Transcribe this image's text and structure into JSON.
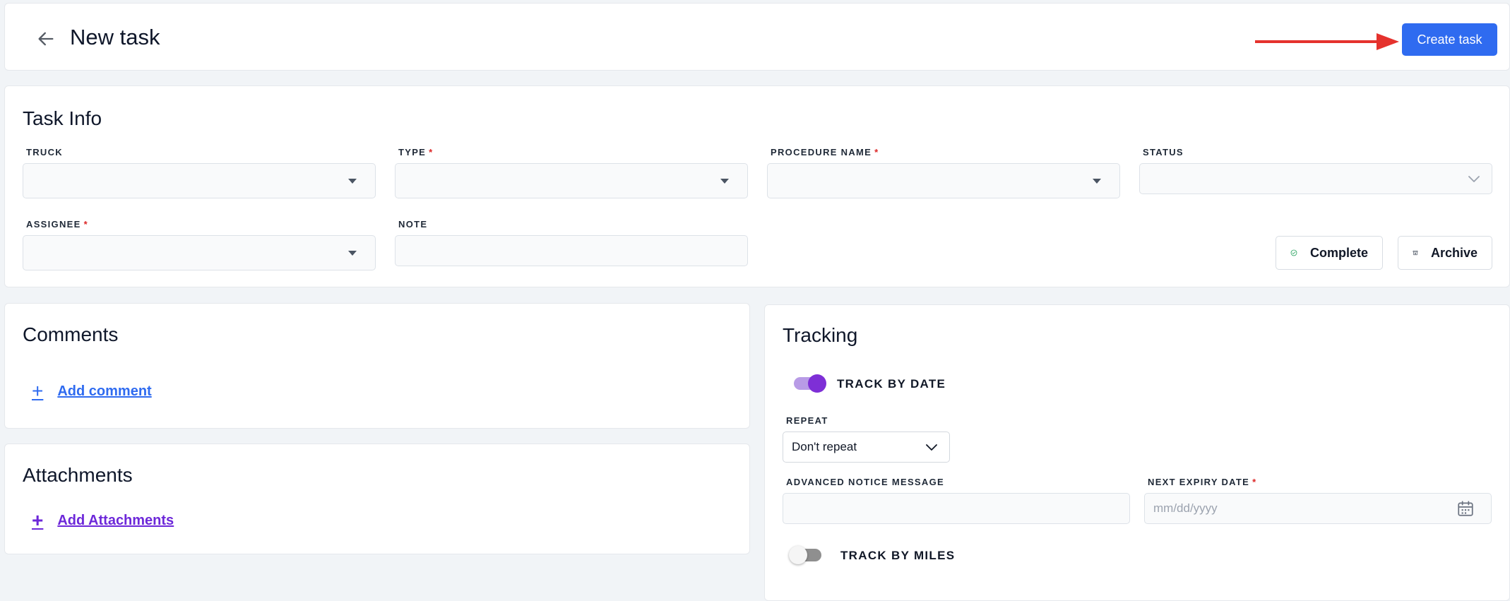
{
  "header": {
    "title": "New task",
    "create_label": "Create task"
  },
  "task_info": {
    "title": "Task Info",
    "fields": {
      "truck": {
        "label": "TRUCK",
        "required": ""
      },
      "type": {
        "label": "TYPE",
        "required": "*"
      },
      "procedure_name": {
        "label": "PROCEDURE NAME",
        "required": "*"
      },
      "status": {
        "label": "STATUS",
        "required": ""
      },
      "assignee": {
        "label": "ASSIGNEE",
        "required": "*"
      },
      "note": {
        "label": "NOTE",
        "required": "",
        "value": ""
      }
    },
    "complete_label": "Complete",
    "archive_label": "Archive"
  },
  "comments": {
    "title": "Comments",
    "add_label": "Add comment"
  },
  "attachments": {
    "title": "Attachments",
    "add_label": "Add Attachments"
  },
  "tracking": {
    "title": "Tracking",
    "track_by_date_label": "TRACK BY DATE",
    "track_by_date_on": true,
    "repeat_label": "REPEAT",
    "repeat_value": "Don't repeat",
    "advanced_notice_label": "ADVANCED NOTICE MESSAGE",
    "advanced_notice_value": "",
    "next_expiry_label": "NEXT EXPIRY DATE",
    "next_expiry_required": "*",
    "next_expiry_placeholder": "mm/dd/yyyy",
    "track_by_miles_label": "TRACK BY MILES",
    "track_by_miles_on": false
  },
  "colors": {
    "primary": "#2f6bf0",
    "comment_link": "#2f6bf0",
    "attachment_link": "#6d28d9",
    "toggle_on": "#7e2fd6",
    "required": "#dc2626",
    "annotation_arrow": "#e5322d"
  }
}
